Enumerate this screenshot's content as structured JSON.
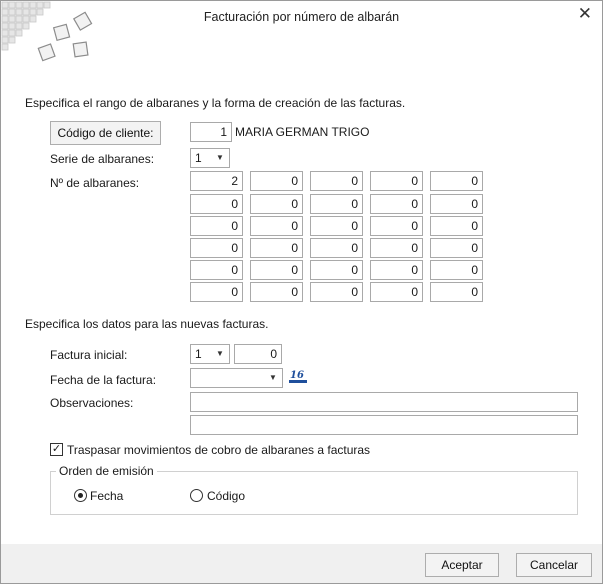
{
  "window": {
    "title": "Facturación por número de albarán",
    "close_glyph": "✕"
  },
  "range_section": {
    "heading": "Especifica el rango de albaranes y la forma de creación de las facturas.",
    "client_button_label": "Código de cliente:",
    "client_code": "1",
    "client_name": "MARIA GERMAN TRIGO",
    "series_label": "Serie de albaranes:",
    "series_value": "1",
    "albaranes_label": "Nº de albaranes:",
    "albaranes_grid": [
      [
        "2",
        "0",
        "0",
        "0",
        "0"
      ],
      [
        "0",
        "0",
        "0",
        "0",
        "0"
      ],
      [
        "0",
        "0",
        "0",
        "0",
        "0"
      ],
      [
        "0",
        "0",
        "0",
        "0",
        "0"
      ],
      [
        "0",
        "0",
        "0",
        "0",
        "0"
      ],
      [
        "0",
        "0",
        "0",
        "0",
        "0"
      ]
    ]
  },
  "invoice_section": {
    "heading": "Especifica los datos para las nuevas facturas.",
    "factura_inicial_label": "Factura inicial:",
    "factura_serie": "1",
    "factura_numero": "0",
    "fecha_label": "Fecha de la factura:",
    "fecha_value": "",
    "observaciones_label": "Observaciones:",
    "observaciones_line1": "",
    "observaciones_line2": "",
    "traspasar_label": "Traspasar movimientos de cobro de albaranes a facturas",
    "traspasar_checked": true,
    "orden_group_title": "Orden de emisión",
    "orden_options": [
      {
        "label": "Fecha",
        "selected": true
      },
      {
        "label": "Código",
        "selected": false
      }
    ]
  },
  "footer": {
    "accept_label": "Aceptar",
    "cancel_label": "Cancelar"
  },
  "icons": {
    "combo_arrow": "▼",
    "check_glyph": "✓",
    "calendar_icon_text": "16"
  }
}
